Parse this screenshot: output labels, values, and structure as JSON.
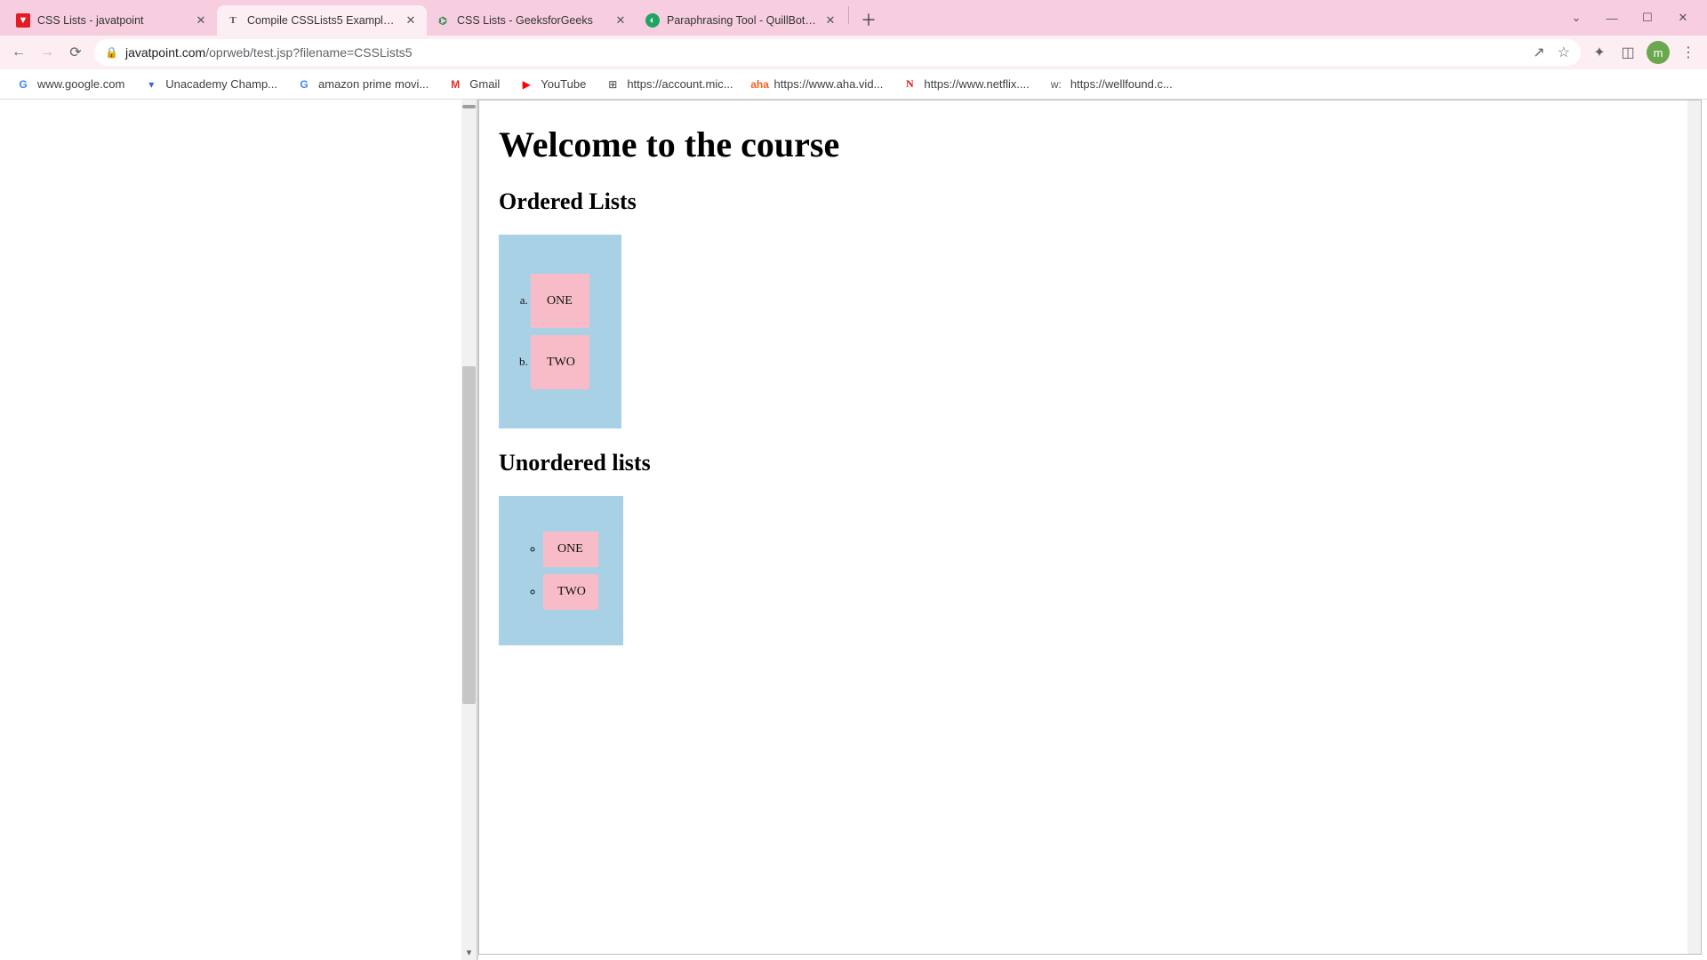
{
  "tabs": [
    {
      "title": "CSS Lists - javatpoint",
      "favstyle": "fv-jp",
      "favtext": "▼",
      "active": false
    },
    {
      "title": "Compile CSSLists5 Example: Edit…",
      "favstyle": "fv-t",
      "favtext": "T",
      "active": true
    },
    {
      "title": "CSS Lists - GeeksforGeeks",
      "favstyle": "fv-gfg",
      "favtext": "⌬",
      "active": false
    },
    {
      "title": "Paraphrasing Tool - QuillBot AI",
      "favstyle": "fv-qb",
      "favtext": "◐",
      "active": false
    }
  ],
  "win": {
    "chevron": "⌄",
    "min": "—",
    "max": "☐",
    "close": "✕"
  },
  "nav": {
    "back": "←",
    "forward": "→",
    "reload": "⟳"
  },
  "addr": {
    "lock": "🔒",
    "host": "javatpoint.com",
    "path": "/oprweb/test.jsp?filename=CSSLists5",
    "share": "↗",
    "star": "☆"
  },
  "toolbar_right": {
    "ext": "✦",
    "panel": "◫",
    "profile": "m",
    "menu": "⋮"
  },
  "bookmarks": [
    {
      "icon_class": "bi-google",
      "icon": "G",
      "label": "www.google.com"
    },
    {
      "icon_class": "bi-un",
      "icon": "▾",
      "label": "Unacademy Champ..."
    },
    {
      "icon_class": "bi-google",
      "icon": "G",
      "label": "amazon prime movi..."
    },
    {
      "icon_class": "bi-gmail",
      "icon": "M",
      "label": "Gmail"
    },
    {
      "icon_class": "bi-yt",
      "icon": "▶",
      "label": "YouTube"
    },
    {
      "icon_class": "bi-ms",
      "icon": "⊞",
      "label": "https://account.mic..."
    },
    {
      "icon_class": "bi-aha",
      "icon": "aha",
      "label": "https://www.aha.vid..."
    },
    {
      "icon_class": "bi-nf",
      "icon": "N",
      "label": "https://www.netflix...."
    },
    {
      "icon_class": "bi-wf",
      "icon": "w:",
      "label": "https://wellfound.c..."
    }
  ],
  "page": {
    "h1": "Welcome to the course",
    "h2a": "Ordered Lists",
    "h2b": "Unordered lists",
    "ol": [
      "ONE",
      "TWO"
    ],
    "ul": [
      "ONE",
      "TWO"
    ]
  }
}
